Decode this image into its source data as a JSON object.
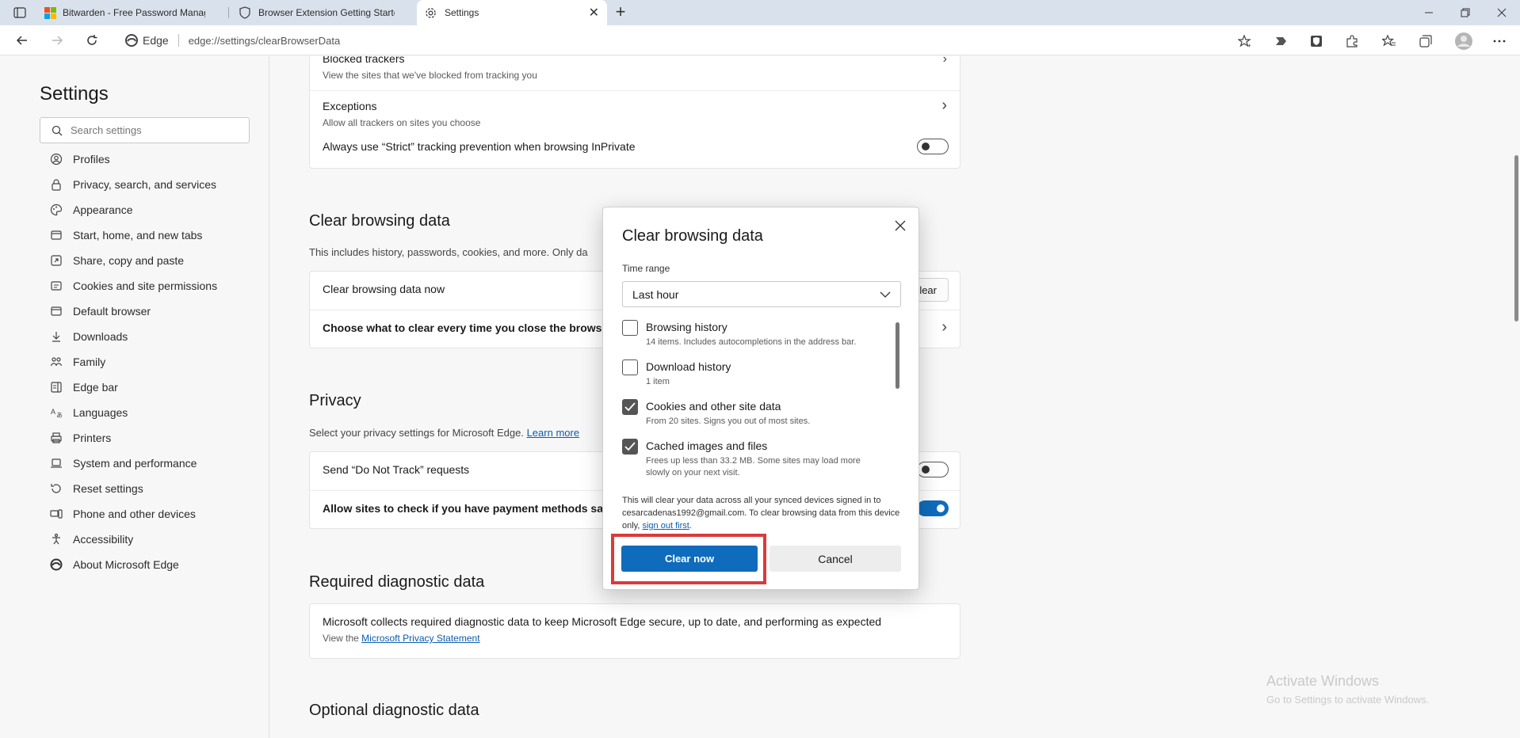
{
  "tabs": [
    {
      "title": "Bitwarden - Free Password Manager",
      "active": false
    },
    {
      "title": "Browser Extension Getting Started",
      "active": false
    },
    {
      "title": "Settings",
      "active": true
    }
  ],
  "address_bar": {
    "site_label": "Edge",
    "url": "edge://settings/clearBrowserData"
  },
  "sidebar": {
    "title": "Settings",
    "search_placeholder": "Search settings",
    "items": [
      {
        "label": "Profiles",
        "icon": "profile-icon"
      },
      {
        "label": "Privacy, search, and services",
        "icon": "lock-icon"
      },
      {
        "label": "Appearance",
        "icon": "palette-icon"
      },
      {
        "label": "Start, home, and new tabs",
        "icon": "power-icon"
      },
      {
        "label": "Share, copy and paste",
        "icon": "share-icon"
      },
      {
        "label": "Cookies and site permissions",
        "icon": "cookie-icon"
      },
      {
        "label": "Default browser",
        "icon": "browser-icon"
      },
      {
        "label": "Downloads",
        "icon": "download-icon"
      },
      {
        "label": "Family",
        "icon": "family-icon"
      },
      {
        "label": "Edge bar",
        "icon": "edge-bar-icon"
      },
      {
        "label": "Languages",
        "icon": "languages-icon"
      },
      {
        "label": "Printers",
        "icon": "printer-icon"
      },
      {
        "label": "System and performance",
        "icon": "laptop-icon"
      },
      {
        "label": "Reset settings",
        "icon": "reset-icon"
      },
      {
        "label": "Phone and other devices",
        "icon": "phone-icon"
      },
      {
        "label": "Accessibility",
        "icon": "accessibility-icon"
      },
      {
        "label": "About Microsoft Edge",
        "icon": "edge-logo-icon"
      }
    ]
  },
  "content": {
    "tracking_card": {
      "blocked_trackers": {
        "label": "Blocked trackers",
        "desc": "View the sites that we've blocked from tracking you"
      },
      "exceptions": {
        "label": "Exceptions",
        "desc": "Allow all trackers on sites you choose"
      },
      "strict": {
        "label": "Always use “Strict” tracking prevention when browsing InPrivate",
        "enabled": false
      }
    },
    "clear_section": {
      "title": "Clear browsing data",
      "desc": "This includes history, passwords, cookies, and more. Only da",
      "now_label": "Clear browsing data now",
      "now_button": "clear",
      "choose_label": "Choose what to clear every time you close the browser"
    },
    "privacy_section": {
      "title": "Privacy",
      "desc": "Select your privacy settings for Microsoft Edge.",
      "learn_more": "Learn more",
      "dnt_label": "Send “Do Not Track” requests",
      "dnt_enabled": false,
      "payment_label": "Allow sites to check if you have payment methods saved",
      "payment_enabled": true
    },
    "required_section": {
      "title": "Required diagnostic data",
      "card_title": "Microsoft collects required diagnostic data to keep Microsoft Edge secure, up to date, and performing as expected",
      "view_prefix": "View the",
      "privacy_link": "Microsoft Privacy Statement"
    },
    "optional_section": {
      "title": "Optional diagnostic data"
    }
  },
  "watermark": {
    "line1": "Activate Windows",
    "line2": "Go to Settings to activate Windows."
  },
  "dialog": {
    "title": "Clear browsing data",
    "time_range_label": "Time range",
    "time_range_value": "Last hour",
    "items": [
      {
        "label": "Browsing history",
        "desc": "14 items. Includes autocompletions in the address bar.",
        "checked": false
      },
      {
        "label": "Download history",
        "desc": "1 item",
        "checked": false
      },
      {
        "label": "Cookies and other site data",
        "desc": "From 20 sites. Signs you out of most sites.",
        "checked": true
      },
      {
        "label": "Cached images and files",
        "desc": "Frees up less than 33.2 MB. Some sites may load more slowly on your next visit.",
        "checked": true
      }
    ],
    "sync_note": "This will clear your data across all your synced devices signed in to cesarcadenas1992@gmail.com. To clear browsing data from this device only,",
    "sign_out_link": "sign out first",
    "clear_button": "Clear now",
    "cancel_button": "Cancel"
  },
  "colors": {
    "accent": "#0f6cbd",
    "highlight": "#d93b3b"
  }
}
